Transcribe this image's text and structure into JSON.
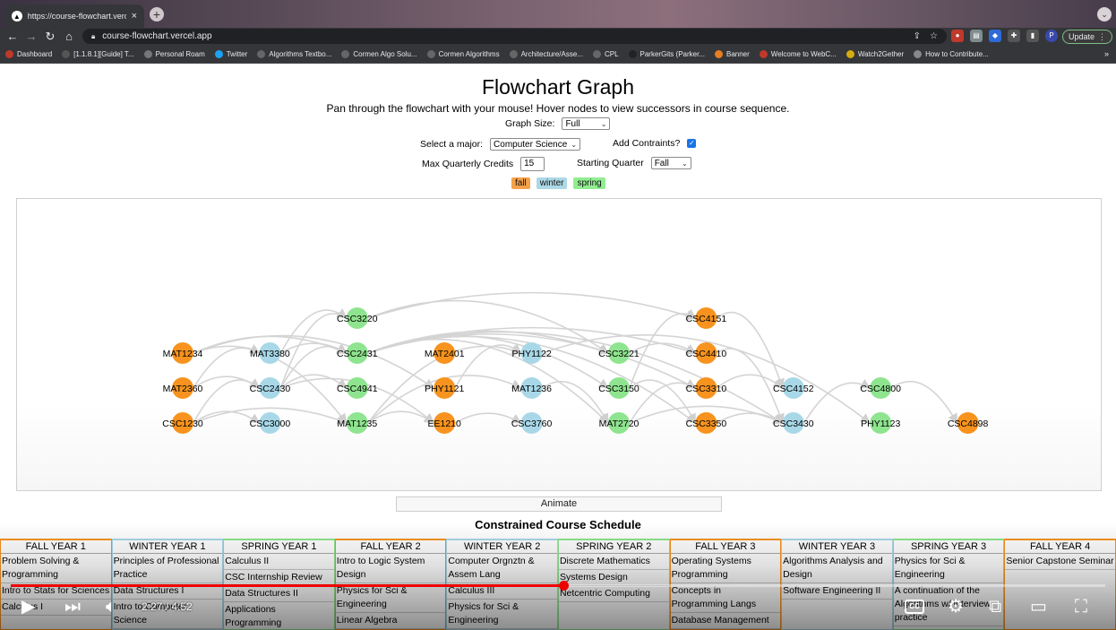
{
  "browser": {
    "tab_title": "https://course-flowchart.vercel.app",
    "tab_close": "×",
    "new_tab": "+",
    "tab_menu": "⌄",
    "url": "course-flowchart.vercel.app",
    "update_label": "Update",
    "bookmarks": [
      {
        "label": "Dashboard",
        "color": "#c0392b"
      },
      {
        "label": "[1.1.8.1][Guide] T...",
        "color": "#555"
      },
      {
        "label": "Personal Roam",
        "color": "#777"
      },
      {
        "label": "Twitter",
        "color": "#1da1f2"
      },
      {
        "label": "Algorithms Textbo...",
        "color": "#666"
      },
      {
        "label": "Cormen Algo Solu...",
        "color": "#666"
      },
      {
        "label": "Cormen Algorithms",
        "color": "#666"
      },
      {
        "label": "Architecture/Asse...",
        "color": "#666"
      },
      {
        "label": "CPL",
        "color": "#666"
      },
      {
        "label": "ParkerGits (Parker...",
        "color": "#222"
      },
      {
        "label": "Banner",
        "color": "#e67e22"
      },
      {
        "label": "Welcome to WebC...",
        "color": "#c0392b"
      },
      {
        "label": "Watch2Gether",
        "color": "#d4ac0d"
      },
      {
        "label": "How to Contribute...",
        "color": "#888"
      }
    ],
    "bookmarks_more": "»"
  },
  "page": {
    "title": "Flowchart Graph",
    "subtitle": "Pan through the flowchart with your mouse! Hover nodes to view successors in course sequence.",
    "graph_size_label": "Graph Size:",
    "graph_size_value": "Full",
    "major_label": "Select a major:",
    "major_value": "Computer Science",
    "constraints_label": "Add Contraints?",
    "max_credits_label": "Max Quarterly Credits",
    "max_credits_value": "15",
    "start_quarter_label": "Starting Quarter",
    "start_quarter_value": "Fall",
    "legend": [
      {
        "label": "fall",
        "color": "#f5a14a"
      },
      {
        "label": "winter",
        "color": "#add8e6"
      },
      {
        "label": "spring",
        "color": "#90ee90"
      }
    ],
    "animate_label": "Animate",
    "schedule_title": "Constrained Course Schedule"
  },
  "colors": {
    "fall": "#f7931e",
    "winter": "#a8d8e8",
    "spring": "#8fe48f",
    "edge": "#d4d4d4"
  },
  "graph": {
    "nodes": [
      {
        "id": "CSC3220",
        "term": "spring",
        "col": 2,
        "row": 0
      },
      {
        "id": "CSC4151",
        "term": "fall",
        "col": 6,
        "row": 0
      },
      {
        "id": "MAT1234",
        "term": "fall",
        "col": 0,
        "row": 1
      },
      {
        "id": "MAT3380",
        "term": "winter",
        "col": 1,
        "row": 1
      },
      {
        "id": "CSC2431",
        "term": "spring",
        "col": 2,
        "row": 1
      },
      {
        "id": "MAT2401",
        "term": "fall",
        "col": 3,
        "row": 1
      },
      {
        "id": "PHY1122",
        "term": "winter",
        "col": 4,
        "row": 1
      },
      {
        "id": "CSC3221",
        "term": "spring",
        "col": 5,
        "row": 1
      },
      {
        "id": "CSC4410",
        "term": "fall",
        "col": 6,
        "row": 1
      },
      {
        "id": "MAT2360",
        "term": "fall",
        "col": 0,
        "row": 2
      },
      {
        "id": "CSC2430",
        "term": "winter",
        "col": 1,
        "row": 2
      },
      {
        "id": "CSC4941",
        "term": "spring",
        "col": 2,
        "row": 2
      },
      {
        "id": "PHY1121",
        "term": "fall",
        "col": 3,
        "row": 2
      },
      {
        "id": "MAT1236",
        "term": "winter",
        "col": 4,
        "row": 2
      },
      {
        "id": "CSC3150",
        "term": "spring",
        "col": 5,
        "row": 2
      },
      {
        "id": "CSC3310",
        "term": "fall",
        "col": 6,
        "row": 2
      },
      {
        "id": "CSC4152",
        "term": "winter",
        "col": 7,
        "row": 2
      },
      {
        "id": "CSC4800",
        "term": "spring",
        "col": 8,
        "row": 2
      },
      {
        "id": "CSC1230",
        "term": "fall",
        "col": 0,
        "row": 3
      },
      {
        "id": "CSC3000",
        "term": "winter",
        "col": 1,
        "row": 3
      },
      {
        "id": "MAT1235",
        "term": "spring",
        "col": 2,
        "row": 3
      },
      {
        "id": "EE1210",
        "term": "fall",
        "col": 3,
        "row": 3
      },
      {
        "id": "CSC3760",
        "term": "winter",
        "col": 4,
        "row": 3
      },
      {
        "id": "MAT2720",
        "term": "spring",
        "col": 5,
        "row": 3
      },
      {
        "id": "CSC3350",
        "term": "fall",
        "col": 6,
        "row": 3
      },
      {
        "id": "CSC3430",
        "term": "winter",
        "col": 7,
        "row": 3
      },
      {
        "id": "PHY1123",
        "term": "spring",
        "col": 8,
        "row": 3
      },
      {
        "id": "CSC4898",
        "term": "fall",
        "col": 9,
        "row": 3
      }
    ],
    "edges": [
      [
        "MAT1234",
        "MAT1235"
      ],
      [
        "MAT1234",
        "CSC2431"
      ],
      [
        "MAT1234",
        "PHY1121"
      ],
      [
        "MAT2360",
        "MAT3380"
      ],
      [
        "MAT2360",
        "CSC2430"
      ],
      [
        "CSC1230",
        "CSC2430"
      ],
      [
        "CSC1230",
        "MAT1235"
      ],
      [
        "CSC1230",
        "CSC3000"
      ],
      [
        "MAT3380",
        "CSC3220"
      ],
      [
        "MAT3380",
        "CSC2431"
      ],
      [
        "CSC2430",
        "CSC2431"
      ],
      [
        "CSC2430",
        "CSC4941"
      ],
      [
        "CSC2430",
        "EE1210"
      ],
      [
        "CSC2430",
        "CSC3220"
      ],
      [
        "MAT1235",
        "MAT1236"
      ],
      [
        "MAT1235",
        "PHY1122"
      ],
      [
        "MAT1235",
        "EE1210"
      ],
      [
        "CSC3220",
        "CSC3221"
      ],
      [
        "CSC3220",
        "CSC4151"
      ],
      [
        "CSC2431",
        "CSC3221"
      ],
      [
        "CSC2431",
        "CSC3150"
      ],
      [
        "CSC2431",
        "CSC3310"
      ],
      [
        "CSC2431",
        "CSC3430"
      ],
      [
        "CSC2431",
        "MAT2720"
      ],
      [
        "CSC2431",
        "CSC4410"
      ],
      [
        "CSC2431",
        "CSC3350"
      ],
      [
        "PHY1121",
        "PHY1122"
      ],
      [
        "EE1210",
        "CSC3760"
      ],
      [
        "MAT1236",
        "MAT2720"
      ],
      [
        "PHY1122",
        "PHY1123"
      ],
      [
        "CSC3221",
        "CSC4410"
      ],
      [
        "CSC3150",
        "CSC4151"
      ],
      [
        "CSC3150",
        "CSC3350"
      ],
      [
        "MAT2720",
        "CSC3310"
      ],
      [
        "MAT2720",
        "CSC3430"
      ],
      [
        "CSC3310",
        "CSC4152"
      ],
      [
        "CSC3350",
        "CSC3430"
      ],
      [
        "CSC4410",
        "CSC3430"
      ],
      [
        "CSC4151",
        "CSC4152"
      ],
      [
        "CSC3430",
        "CSC4800"
      ],
      [
        "CSC4800",
        "CSC4898"
      ]
    ]
  },
  "schedule": [
    {
      "head": "FALL YEAR 1",
      "term": "fall",
      "courses": [
        "Problem Solving & Programming",
        "Intro to Stats for Sciences",
        "Calculus I"
      ]
    },
    {
      "head": "WINTER YEAR 1",
      "term": "winter",
      "courses": [
        "Principles of Professional Practice",
        "Data Structures I",
        "Intro to Computer Science"
      ]
    },
    {
      "head": "SPRING YEAR 1",
      "term": "spring",
      "courses": [
        "Calculus II",
        "CSC Internship Review",
        "Data Structures II",
        "Applications Programming"
      ]
    },
    {
      "head": "FALL YEAR 2",
      "term": "fall",
      "courses": [
        "Intro to Logic System Design",
        "Physics for Sci & Engineering",
        "Linear Algebra"
      ]
    },
    {
      "head": "WINTER YEAR 2",
      "term": "winter",
      "courses": [
        "Computer Orgnztn & Assem Lang",
        "Calculus III",
        "Physics for Sci & Engineering"
      ]
    },
    {
      "head": "SPRING YEAR 2",
      "term": "spring",
      "courses": [
        "Discrete Mathematics",
        "Systems Design",
        "Netcentric Computing"
      ]
    },
    {
      "head": "FALL YEAR 3",
      "term": "fall",
      "courses": [
        "Operating Systems Programming",
        "Concepts in Programming Langs",
        "Database Management"
      ]
    },
    {
      "head": "WINTER YEAR 3",
      "term": "winter",
      "courses": [
        "Algorithms Analysis and Design",
        "Software Engineering II"
      ]
    },
    {
      "head": "SPRING YEAR 3",
      "term": "spring",
      "courses": [
        "Physics for Sci & Engineering",
        "A continuation of the Algorithms w/ interview practice"
      ]
    },
    {
      "head": "FALL YEAR 4",
      "term": "fall",
      "courses": [
        "Senior Capstone Seminar"
      ]
    }
  ],
  "video": {
    "timecode": "2:27 / 4:52",
    "progress": 0.505,
    "cc_label": "CC"
  }
}
